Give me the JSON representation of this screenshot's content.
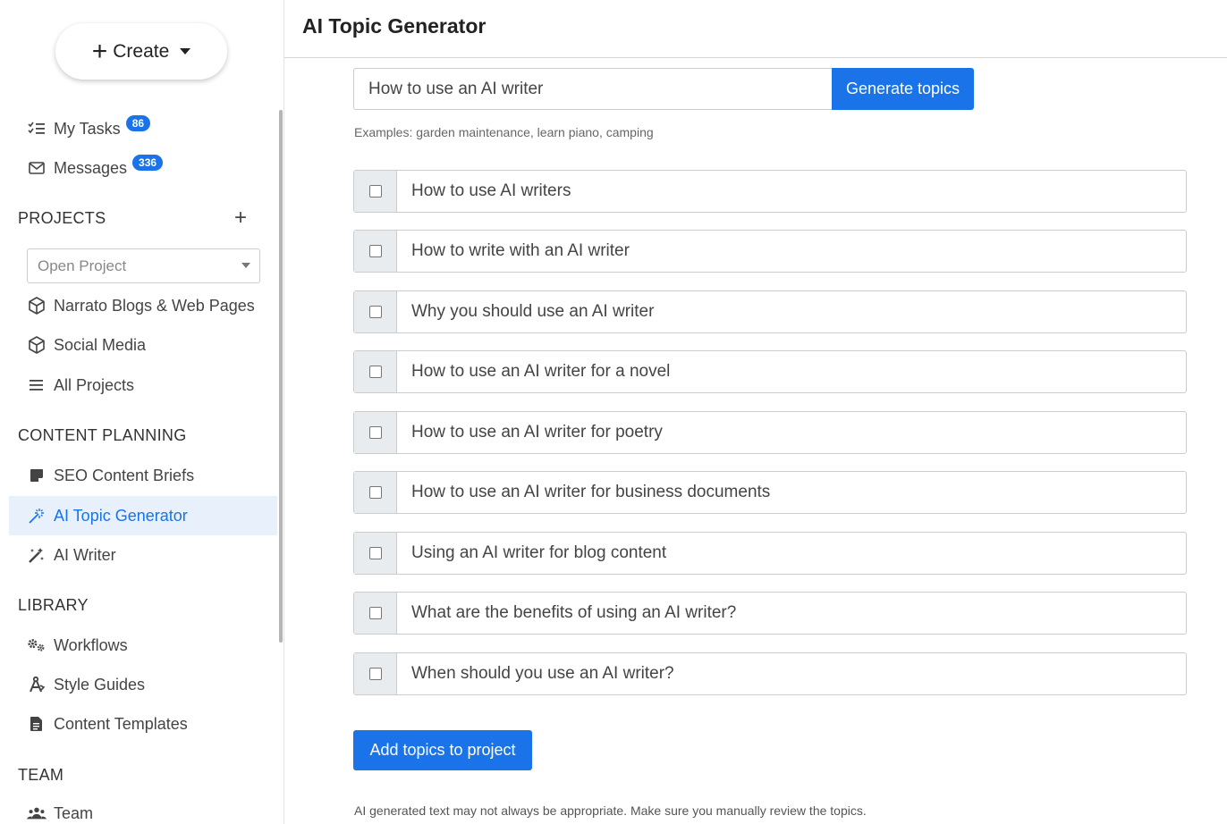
{
  "sidebar": {
    "create_label": "Create",
    "my_tasks": {
      "label": "My Tasks",
      "badge": "86"
    },
    "messages": {
      "label": "Messages",
      "badge": "336"
    },
    "projects_title": "PROJECTS",
    "open_project_placeholder": "Open Project",
    "projects": [
      "Narrato Blogs & Web Pages",
      "Social Media",
      "All Projects"
    ],
    "content_planning_title": "CONTENT PLANNING",
    "content_planning": [
      "SEO Content Briefs",
      "AI Topic Generator",
      "AI Writer"
    ],
    "library_title": "LIBRARY",
    "library": [
      "Workflows",
      "Style Guides",
      "Content Templates"
    ],
    "team_title": "TEAM",
    "team": [
      "Team"
    ]
  },
  "header": {
    "title": "AI Topic Generator"
  },
  "search": {
    "value": "How to use an AI writer",
    "button_label": "Generate topics"
  },
  "examples_text": "Examples: garden maintenance, learn piano, camping",
  "topics": [
    "How to use AI writers",
    "How to write with an AI writer",
    "Why you should use an AI writer",
    "How to use an AI writer for a novel",
    "How to use an AI writer for poetry",
    "How to use an AI writer for business documents",
    "Using an AI writer for blog content",
    "What are the benefits of using an AI writer?",
    "When should you use an AI writer?"
  ],
  "add_button_label": "Add topics to project",
  "disclaimer": "AI generated text may not always be appropriate. Make sure you manually review the topics.",
  "colors": {
    "accent": "#1a73e8",
    "active_bg": "#e8f1fb"
  }
}
